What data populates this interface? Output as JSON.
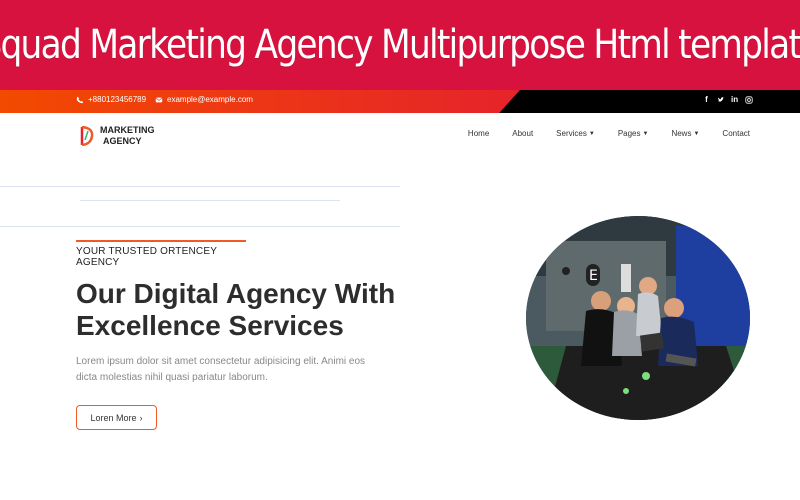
{
  "banner": {
    "title": "Squad Marketing Agency Multipurpose Html template"
  },
  "topbar": {
    "phone": "+880123456789",
    "email": "example@example.com",
    "socials": [
      "facebook-icon",
      "twitter-icon",
      "linkedin-icon",
      "instagram-icon"
    ]
  },
  "logo": {
    "line1": "MARKETING",
    "line2": "AGENCY"
  },
  "nav": {
    "home": "Home",
    "about": "About",
    "services": "Services",
    "pages": "Pages",
    "news": "News",
    "contact": "Contact"
  },
  "hero": {
    "tagline": "YOUR TRUSTED ORTENCEY AGENCY",
    "title_line1": "Our Digital Agency With",
    "title_line2": "Excellence Services",
    "description": "Lorem ipsum dolor sit amet consectetur adipisicing elit. Animi eos dicta molestias nihil quasi pariatur laborum.",
    "button_label": "Loren More"
  },
  "colors": {
    "banner": "#d8123f",
    "accent": "#f05a28",
    "topbar_dark": "#000000"
  }
}
